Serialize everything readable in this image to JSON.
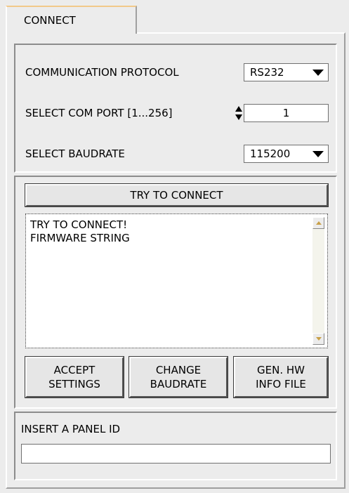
{
  "tab": {
    "label": "CONNECT"
  },
  "comm": {
    "protocol_label": "COMMUNICATION PROTOCOL",
    "protocol_value": "RS232",
    "port_label": "SELECT COM PORT [1...256]",
    "port_value": "1",
    "baud_label": "SELECT BAUDRATE",
    "baud_value": "115200"
  },
  "connect": {
    "button_label": "TRY TO CONNECT",
    "log_lines": [
      "TRY TO CONNECT!",
      "FIRMWARE STRING"
    ],
    "accept_line1": "ACCEPT",
    "accept_line2": "SETTINGS",
    "change_line1": "CHANGE",
    "change_line2": "BAUDRATE",
    "gen_line1": "GEN. HW",
    "gen_line2": "INFO FILE"
  },
  "panel_id": {
    "label": "INSERT A PANEL ID",
    "value": ""
  }
}
